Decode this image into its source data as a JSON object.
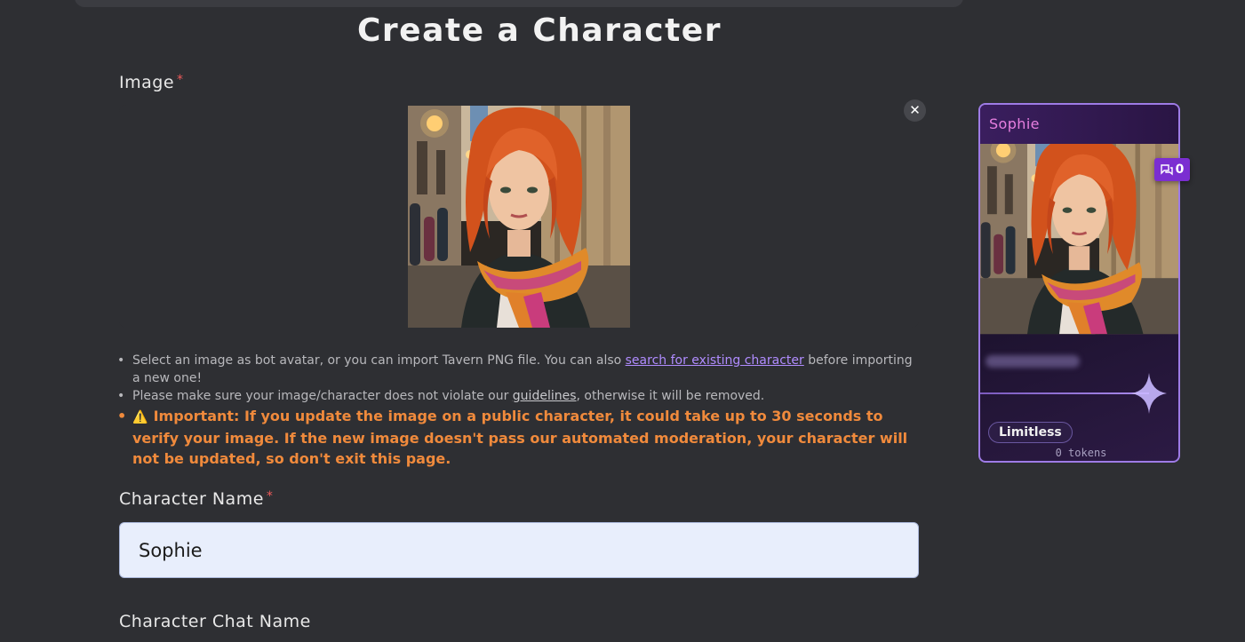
{
  "page": {
    "title": "Create a Character"
  },
  "image_field": {
    "label": "Image",
    "required_mark": "*"
  },
  "notes": {
    "n1_pre": "Select an image as bot avatar, or you can import Tavern PNG file. You can also ",
    "n1_link": "search for existing character",
    "n1_post": " before importing a new one!",
    "n2_pre": "Please make sure your image/character does not violate our ",
    "n2_link": "guidelines",
    "n2_post": ", otherwise it will be removed.",
    "important_label": "Important:",
    "important_text": " If you update the image on a public character, it could take up to 30 seconds to verify your image. If the new image doesn't pass our automated moderation, your character will not be updated, so don't exit this page."
  },
  "name_field": {
    "label": "Character Name",
    "required_mark": "*",
    "value": "Sophie"
  },
  "chat_name_field": {
    "label": "Character Chat Name"
  },
  "preview_card": {
    "name": "Sophie",
    "chat_count": "0",
    "tag": "Limitless",
    "tokens": "0 tokens"
  },
  "icons": {
    "close": "close-icon",
    "warning": "warning-icon",
    "chat": "chat-icon",
    "sparkle": "sparkle-icon"
  },
  "colors": {
    "background": "#2e2f33",
    "accent_purple": "#9e7be6",
    "important_orange": "#f08a3c",
    "link": "#b08cff",
    "card_name": "#e77fe0"
  }
}
